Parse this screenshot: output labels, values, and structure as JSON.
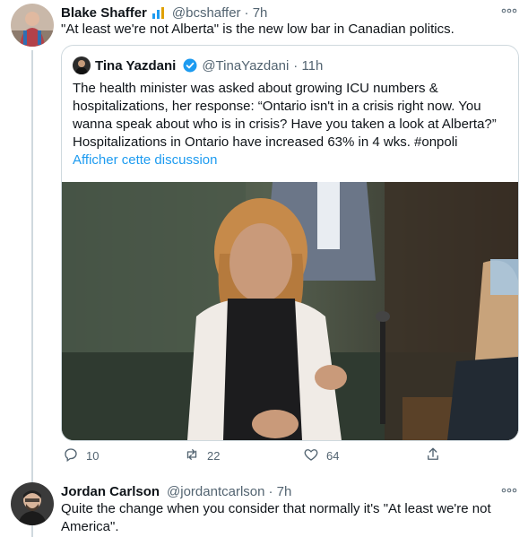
{
  "tweet1": {
    "name": "Blake Shaffer",
    "handle": "@bcshaffer",
    "time": "· 7h",
    "text": "\"At least we're not Alberta\" is the new low bar in Canadian politics.",
    "more_icon": "more-horizontal-icon"
  },
  "quote": {
    "name": "Tina Yazdani",
    "handle": "@TinaYazdani",
    "time": "· 11h",
    "text": "The health minister was asked about growing ICU numbers & hospitalizations, her response: “Ontario isn't in a crisis right now. You wanna speak about who is in crisis? Have you taken a look at Alberta?” Hospitalizations in Ontario have increased 63% in 4 wks.  #onpoli",
    "show_thread": "Afficher cette discussion"
  },
  "actions": {
    "reply_count": "10",
    "retweet_count": "22",
    "like_count": "64"
  },
  "tweet2": {
    "name": "Jordan Carlson",
    "handle": "@jordantcarlson",
    "time": "· 7h",
    "text": "Quite the change when you consider that normally it's \"At least we're not America\"."
  },
  "colors": {
    "accent": "#1d9bf0",
    "muted": "#536471",
    "border": "#cfd9de"
  }
}
